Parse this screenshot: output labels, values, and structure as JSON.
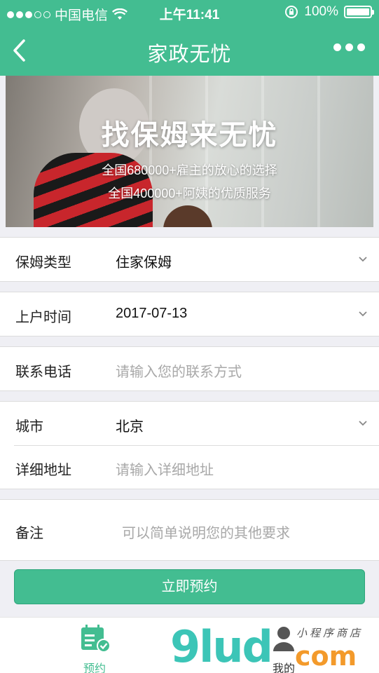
{
  "status_bar": {
    "carrier": "中国电信",
    "time": "上午11:41",
    "battery": "100%"
  },
  "nav": {
    "title": "家政无忧"
  },
  "banner": {
    "headline": "找保姆来无忧",
    "line1": "全国680000+雇主的放心的选择",
    "line2": "全国400000+阿姨的优质服务"
  },
  "form": {
    "nanny_type": {
      "label": "保姆类型",
      "value": "住家保姆"
    },
    "start_date": {
      "label": "上户时间",
      "value": "2017-07-13"
    },
    "phone": {
      "label": "联系电话",
      "placeholder": "请输入您的联系方式"
    },
    "city": {
      "label": "城市",
      "value": "北京"
    },
    "address": {
      "label": "详细地址",
      "placeholder": "请输入详细地址"
    },
    "remark": {
      "label": "备注",
      "placeholder": "可以简单说明您的其他要求"
    }
  },
  "submit_label": "立即预约",
  "tabbar": {
    "items": [
      {
        "label": "预约",
        "icon": "calendar-check-icon",
        "active": true
      },
      {
        "label": "我的",
        "icon": "user-icon",
        "active": false
      }
    ]
  },
  "watermark": {
    "brand": "9lud",
    "domain": "com",
    "cn": "小程序商店"
  },
  "colors": {
    "primary": "#43bd91",
    "background": "#efeff4",
    "placeholder": "#a8a8a8"
  }
}
